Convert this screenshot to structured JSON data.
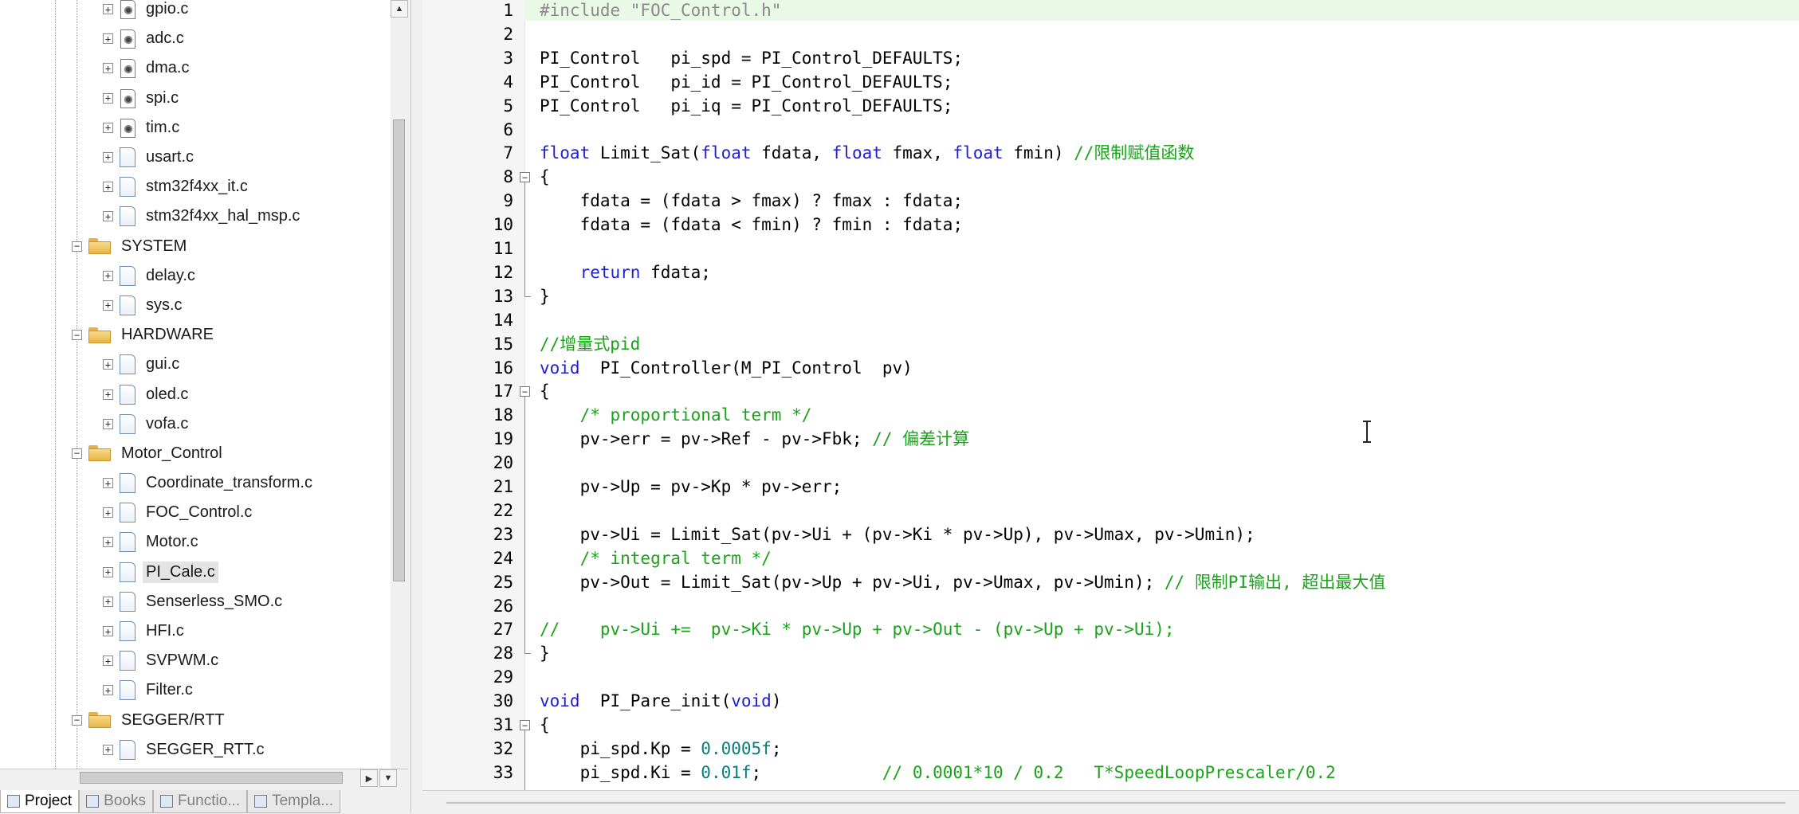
{
  "project_tree": {
    "items": [
      {
        "label": "gpio.c",
        "type": "gear-file",
        "level": 2
      },
      {
        "label": "adc.c",
        "type": "gear-file",
        "level": 2
      },
      {
        "label": "dma.c",
        "type": "gear-file",
        "level": 2
      },
      {
        "label": "spi.c",
        "type": "gear-file",
        "level": 2
      },
      {
        "label": "tim.c",
        "type": "gear-file",
        "level": 2
      },
      {
        "label": "usart.c",
        "type": "file",
        "level": 2
      },
      {
        "label": "stm32f4xx_it.c",
        "type": "file",
        "level": 2
      },
      {
        "label": "stm32f4xx_hal_msp.c",
        "type": "file",
        "level": 2
      },
      {
        "label": "SYSTEM",
        "type": "folder",
        "level": 1
      },
      {
        "label": "delay.c",
        "type": "file",
        "level": 2
      },
      {
        "label": "sys.c",
        "type": "file",
        "level": 2
      },
      {
        "label": "HARDWARE",
        "type": "folder",
        "level": 1
      },
      {
        "label": "gui.c",
        "type": "file",
        "level": 2
      },
      {
        "label": "oled.c",
        "type": "file",
        "level": 2
      },
      {
        "label": "vofa.c",
        "type": "file",
        "level": 2
      },
      {
        "label": "Motor_Control",
        "type": "folder",
        "level": 1
      },
      {
        "label": "Coordinate_transform.c",
        "type": "file",
        "level": 2
      },
      {
        "label": "FOC_Control.c",
        "type": "file",
        "level": 2
      },
      {
        "label": "Motor.c",
        "type": "file",
        "level": 2
      },
      {
        "label": "PI_Cale.c",
        "type": "file",
        "level": 2,
        "selected": true
      },
      {
        "label": "Senserless_SMO.c",
        "type": "file",
        "level": 2
      },
      {
        "label": "HFI.c",
        "type": "file",
        "level": 2
      },
      {
        "label": "SVPWM.c",
        "type": "file",
        "level": 2
      },
      {
        "label": "Filter.c",
        "type": "file",
        "level": 2
      },
      {
        "label": "SEGGER/RTT",
        "type": "folder",
        "level": 1
      },
      {
        "label": "SEGGER_RTT.c",
        "type": "file",
        "level": 2
      }
    ]
  },
  "panel_tabs": [
    {
      "label": "Project",
      "active": true
    },
    {
      "label": "Books",
      "active": false
    },
    {
      "label": "Functio...",
      "active": false
    },
    {
      "label": "Templa...",
      "active": false
    }
  ],
  "colors": {
    "keyword": "#1f1fd0",
    "comment": "#1aa31a",
    "preprocessor": "#8a8a8a",
    "number": "#0a7b7b",
    "current_line": "#e9f9e6"
  },
  "editor": {
    "lines": [
      {
        "n": "1",
        "tokens": [
          [
            "pp",
            "#include \"FOC_Control.h\""
          ]
        ]
      },
      {
        "n": "2",
        "tokens": []
      },
      {
        "n": "3",
        "tokens": [
          [
            "t",
            "PI_Control   pi_spd = PI_Control_DEFAULTS;"
          ]
        ]
      },
      {
        "n": "4",
        "tokens": [
          [
            "t",
            "PI_Control   pi_id = PI_Control_DEFAULTS;"
          ]
        ]
      },
      {
        "n": "5",
        "tokens": [
          [
            "t",
            "PI_Control   pi_iq = PI_Control_DEFAULTS;"
          ]
        ]
      },
      {
        "n": "6",
        "tokens": []
      },
      {
        "n": "7",
        "tokens": [
          [
            "kw",
            "float"
          ],
          [
            "t",
            " Limit_Sat("
          ],
          [
            "kw",
            "float"
          ],
          [
            "t",
            " fdata, "
          ],
          [
            "kw",
            "float"
          ],
          [
            "t",
            " fmax, "
          ],
          [
            "kw",
            "float"
          ],
          [
            "t",
            " fmin) "
          ],
          [
            "cm",
            "//限制赋值函数"
          ]
        ]
      },
      {
        "n": "8",
        "fold": "open",
        "tokens": [
          [
            "t",
            "{"
          ]
        ]
      },
      {
        "n": "9",
        "tokens": [
          [
            "t",
            "    fdata = (fdata > fmax) ? fmax : fdata;"
          ]
        ]
      },
      {
        "n": "10",
        "tokens": [
          [
            "t",
            "    fdata = (fdata < fmin) ? fmin : fdata;"
          ]
        ]
      },
      {
        "n": "11",
        "tokens": []
      },
      {
        "n": "12",
        "tokens": [
          [
            "t",
            "    "
          ],
          [
            "kw",
            "return"
          ],
          [
            "t",
            " fdata;"
          ]
        ]
      },
      {
        "n": "13",
        "fold": "end",
        "tokens": [
          [
            "t",
            "}"
          ]
        ]
      },
      {
        "n": "14",
        "tokens": []
      },
      {
        "n": "15",
        "tokens": [
          [
            "cm",
            "//增量式pid"
          ]
        ]
      },
      {
        "n": "16",
        "tokens": [
          [
            "kw",
            "void"
          ],
          [
            "t",
            "  PI_Controller(M_PI_Control  pv)"
          ]
        ]
      },
      {
        "n": "17",
        "fold": "open",
        "tokens": [
          [
            "t",
            "{"
          ]
        ]
      },
      {
        "n": "18",
        "tokens": [
          [
            "t",
            "    "
          ],
          [
            "cm",
            "/* proportional term */"
          ]
        ]
      },
      {
        "n": "19",
        "tokens": [
          [
            "t",
            "    pv->err = pv->Ref - pv->Fbk; "
          ],
          [
            "cm",
            "// 偏差计算"
          ]
        ]
      },
      {
        "n": "20",
        "tokens": []
      },
      {
        "n": "21",
        "tokens": [
          [
            "t",
            "    pv->Up = pv->Kp * pv->err;"
          ]
        ]
      },
      {
        "n": "22",
        "tokens": []
      },
      {
        "n": "23",
        "tokens": [
          [
            "t",
            "    pv->Ui = Limit_Sat(pv->Ui + (pv->Ki * pv->Up), pv->Umax, pv->Umin);"
          ]
        ]
      },
      {
        "n": "24",
        "tokens": [
          [
            "t",
            "    "
          ],
          [
            "cm",
            "/* integral term */"
          ]
        ]
      },
      {
        "n": "25",
        "tokens": [
          [
            "t",
            "    pv->Out = Limit_Sat(pv->Up + pv->Ui, pv->Umax, pv->Umin); "
          ],
          [
            "cm",
            "// 限制PI输出, 超出最大值"
          ]
        ]
      },
      {
        "n": "26",
        "tokens": []
      },
      {
        "n": "27",
        "tokens": [
          [
            "cm",
            "//    pv->Ui +=  pv->Ki * pv->Up + pv->Out - (pv->Up + pv->Ui);"
          ]
        ]
      },
      {
        "n": "28",
        "fold": "end",
        "tokens": [
          [
            "t",
            "}"
          ]
        ]
      },
      {
        "n": "29",
        "tokens": []
      },
      {
        "n": "30",
        "tokens": [
          [
            "kw",
            "void"
          ],
          [
            "t",
            "  PI_Pare_init("
          ],
          [
            "kw",
            "void"
          ],
          [
            "t",
            ")"
          ]
        ]
      },
      {
        "n": "31",
        "fold": "open",
        "tokens": [
          [
            "t",
            "{"
          ]
        ]
      },
      {
        "n": "32",
        "tokens": [
          [
            "t",
            "    pi_spd.Kp = "
          ],
          [
            "num",
            "0.0005f"
          ],
          [
            "t",
            ";"
          ]
        ]
      },
      {
        "n": "33",
        "tokens": [
          [
            "t",
            "    pi_spd.Ki = "
          ],
          [
            "num",
            "0.01f"
          ],
          [
            "t",
            ";            "
          ],
          [
            "cm",
            "// 0.0001*10 / 0.2   T*SpeedLoopPrescaler/0.2"
          ]
        ]
      }
    ]
  }
}
